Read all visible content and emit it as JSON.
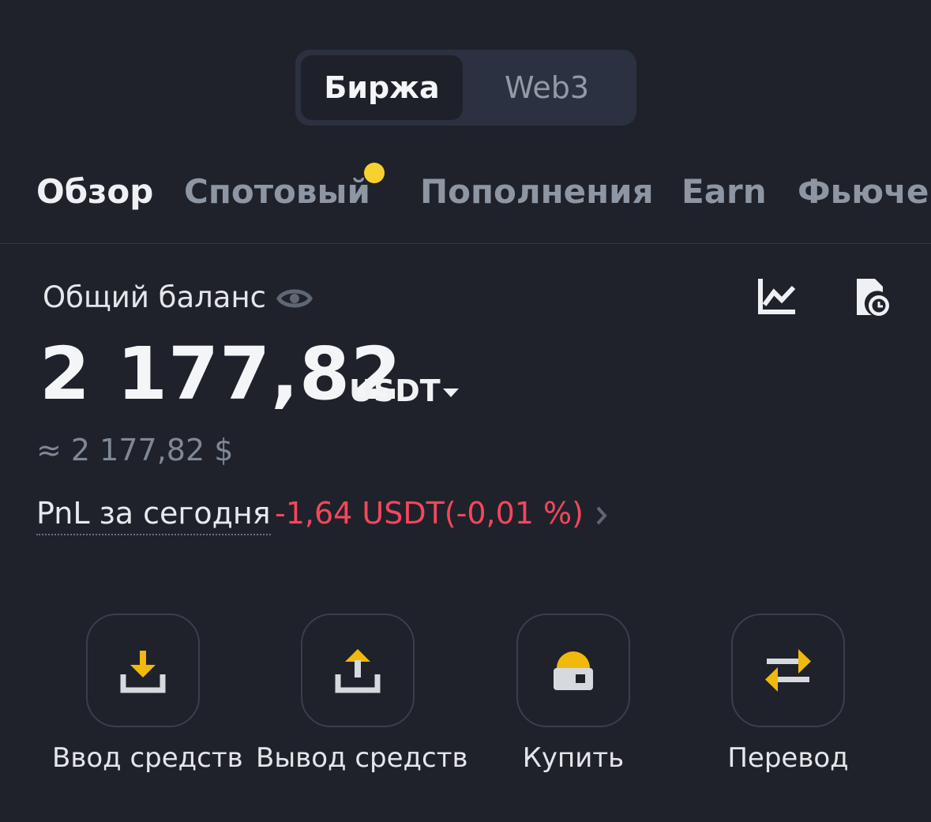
{
  "segment": {
    "active": "Биржа",
    "inactive": "Web3"
  },
  "tabs": [
    {
      "label": "Обзор",
      "active": true
    },
    {
      "label": "Спотовый",
      "badge": true
    },
    {
      "label": "Пополнения"
    },
    {
      "label": "Earn"
    },
    {
      "label": "Фьючерсы"
    }
  ],
  "balance": {
    "label": "Общий баланс",
    "amount": "2 177,82",
    "currency": "USDT",
    "approx": "≈ 2 177,82 $"
  },
  "pnl": {
    "label": "PnL за сегодня",
    "value": "-1,64 USDT(-0,01 %)"
  },
  "actions": [
    {
      "label": "Ввод средств",
      "icon": "deposit-icon"
    },
    {
      "label": "Вывод средств",
      "icon": "withdraw-icon"
    },
    {
      "label": "Купить",
      "icon": "buy-icon"
    },
    {
      "label": "Перевод",
      "icon": "transfer-icon"
    }
  ],
  "colors": {
    "background": "#1f222b",
    "accent": "#f0b90b",
    "negative": "#f6465d",
    "muted": "#8e96a3"
  }
}
